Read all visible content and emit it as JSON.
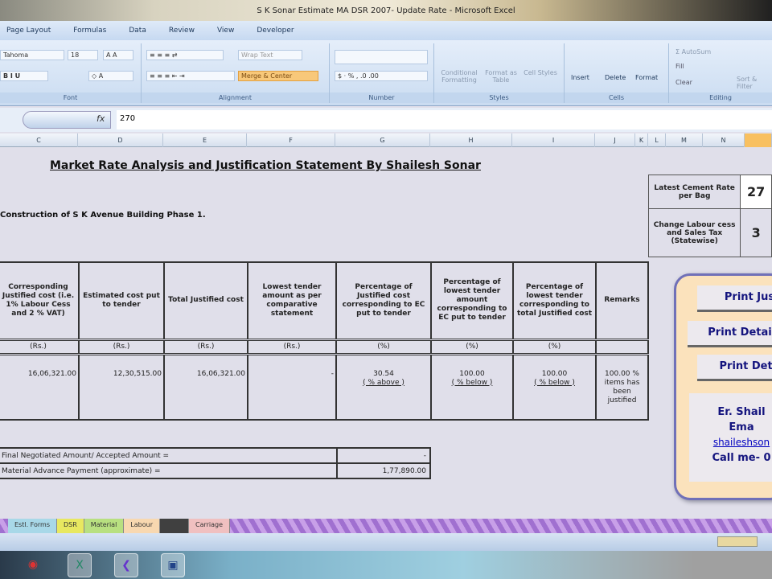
{
  "window": {
    "title": "S K Sonar Estimate MA DSR 2007- Update Rate - Microsoft Excel"
  },
  "menu": [
    "Page Layout",
    "Formulas",
    "Data",
    "Review",
    "View",
    "Developer"
  ],
  "ribbon": {
    "font_name": "Tahoma",
    "font_size": "18",
    "wrap_text": "Wrap Text",
    "merge_center": "Merge & Center",
    "conditional": "Conditional Formatting",
    "format_table": "Format as Table",
    "cell_styles": "Cell Styles",
    "insert": "Insert",
    "delete": "Delete",
    "format": "Format",
    "autosum": "AutoSum",
    "fill": "Fill",
    "clear": "Clear",
    "sort": "Sort & Filter",
    "groups": {
      "font": "Font",
      "alignment": "Alignment",
      "number": "Number",
      "styles": "Styles",
      "cells": "Cells",
      "editing": "Editing"
    }
  },
  "formula": {
    "fx": "fx",
    "value": "270"
  },
  "columns": [
    "C",
    "D",
    "E",
    "F",
    "G",
    "H",
    "I",
    "J",
    "K",
    "L",
    "M",
    "N"
  ],
  "sheet": {
    "title": "Market Rate Analysis and Justification Statement By Shailesh Sonar",
    "subtitle": "Construction of S K Avenue Building Phase 1.",
    "headers": [
      "Corresponding Justified cost (i.e. 1% Labour Cess and 2 % VAT)",
      "Estimated cost put to tender",
      "Total Justified cost",
      "Lowest tender amount as per comparative statement",
      "Percentage of Justified cost corresponding to EC put to tender",
      "Percentage of lowest tender amount corresponding to EC put to tender",
      "Percentage of lowest tender corresponding to total Justified cost",
      "Remarks"
    ],
    "units": [
      "(Rs.)",
      "(Rs.)",
      "(Rs.)",
      "(Rs.)",
      "(%)",
      "(%)",
      "(%)",
      ""
    ],
    "row": {
      "justified": "16,06,321.00",
      "estimated": "12,30,515.00",
      "total": "16,06,321.00",
      "lowest": "-",
      "pct_g": "30.54",
      "pct_g_note": "( % above )",
      "pct_h": "100.00",
      "pct_h_note": "( % below )",
      "pct_i": "100.00",
      "pct_i_note": "( % below )",
      "remarks": "100.00 % items has been justified"
    },
    "summary": [
      {
        "label": "Final Negotiated Amount/ Accepted Amount =",
        "value": "-"
      },
      {
        "label": "Material Advance Payment (approximate) =",
        "value": "1,77,890.00"
      }
    ],
    "cement": {
      "label": "Latest Cement Rate per Bag",
      "value": "27"
    },
    "labour": {
      "label": "Change Labour cess and Sales Tax (Statewise)",
      "value": "3"
    },
    "buttons": [
      "Print Jus",
      "Print Detai",
      "Print Deta"
    ],
    "contact": {
      "name": "Er. Shail",
      "email_label": "Ema",
      "email": "shaileshson",
      "phone": "Call me- 0"
    }
  },
  "tabs": [
    "Estl. Forms",
    "DSR",
    "Material",
    "Labour",
    "",
    "Carriage"
  ],
  "tab_colors": [
    "#a8d8e8",
    "#e8e860",
    "#b8e080",
    "#f8d8b0",
    "#404040",
    "#f0c0c0"
  ]
}
